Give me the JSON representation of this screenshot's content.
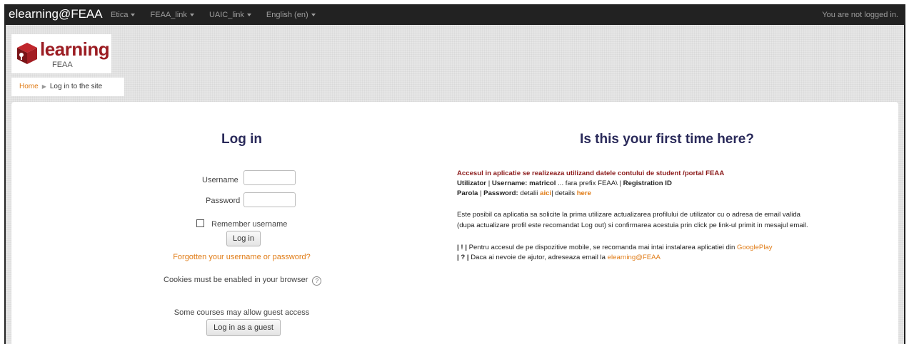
{
  "navbar": {
    "brand": "elearning@FEAA",
    "menu": [
      {
        "label": "Etica"
      },
      {
        "label": "FEAA_link"
      },
      {
        "label": "UAIC_link"
      },
      {
        "label": "English (en)"
      }
    ],
    "login_status": "You are not logged in."
  },
  "header": {
    "logo_text": "learning",
    "logo_sub": "FEAA",
    "breadcrumb": {
      "home": "Home",
      "current": "Log in to the site"
    }
  },
  "login": {
    "title": "Log in",
    "username_label": "Username",
    "password_label": "Password",
    "remember_label": "Remember username",
    "login_button": "Log in",
    "forgot_link": "Forgotten your username or password?",
    "cookies_text": "Cookies must be enabled in your browser",
    "guest_text": "Some courses may allow guest access",
    "guest_button": "Log in as a guest"
  },
  "first_time": {
    "title": "Is this your first time here?",
    "line1": "Accesul in aplicatie se realizeaza utilizand datele contului de student /portal FEAA",
    "line2_a": "Utilizator",
    "line2_b": " | ",
    "line2_c": "Username: matricol",
    "line2_d": " ... fara prefix FEAA\\ | ",
    "line2_e": "Registration ID",
    "line3_a": "Parola",
    "line3_b": " | ",
    "line3_c": "Password:",
    "line3_d": " detalii ",
    "line3_link1": "aici",
    "line3_e": "| details ",
    "line3_link2": "here",
    "line4": "Este posibil ca aplicatia sa solicite la prima utilizare actualizarea profilului de utilizator cu o adresa de email valida",
    "line5": "(dupa actualizare profil este recomandat Log out) si confirmarea acestuia prin click pe link-ul primit in mesajul email.",
    "line6_a": "| ! |",
    "line6_b": " Pentru accesul de pe dispozitive mobile, se recomanda mai intai instalarea aplicatiei din ",
    "line6_link": "GooglePlay",
    "line7_a": "| ? |",
    "line7_b": " Daca ai nevoie de ajutor, adreseaza email la ",
    "line7_link": "elearning@FEAA"
  },
  "colors": {
    "navbar_bg": "#222222",
    "accent_orange": "#e07b15",
    "title_navy": "#2a2a5a",
    "logo_red": "#9b1c22"
  }
}
